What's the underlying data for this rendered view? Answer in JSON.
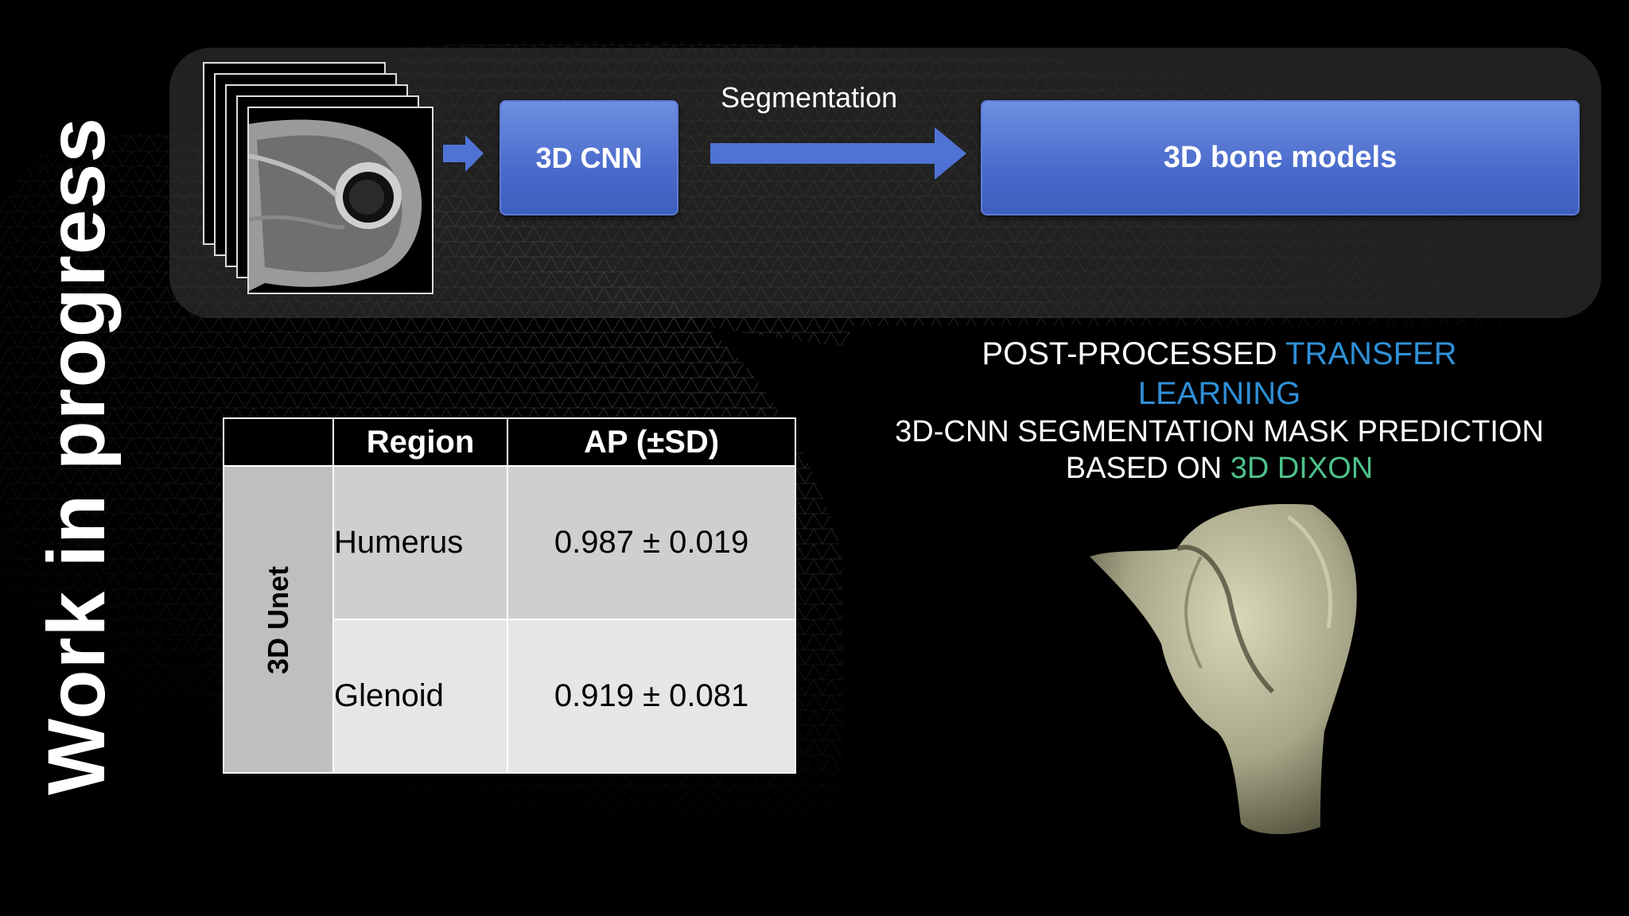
{
  "slide": {
    "vertical_title": "Work in progress"
  },
  "pipeline": {
    "input_icon": "mri-slice-stack-icon",
    "cnn_label": "3D CNN",
    "arrow_label": "Segmentation",
    "output_label": "3D bone models",
    "box_color": "#4a6bcc"
  },
  "table": {
    "headers": [
      "",
      "Region",
      "AP (±SD)"
    ],
    "row_group_label": "3D Unet",
    "rows": [
      {
        "region": "Humerus",
        "value": "0.987 ± 0.019"
      },
      {
        "region": "Glenoid",
        "value": "0.919 ± 0.081"
      }
    ]
  },
  "caption": {
    "line1_part1": "POST-PROCESSED ",
    "line1_part2": "TRANSFER",
    "line2": "LEARNING",
    "line3": "3D-CNN SEGMENTATION MASK PREDICTION",
    "line4_part1": "BASED ON ",
    "line4_part2": "3D DIXON",
    "highlight_blue": "#2f8fd6",
    "highlight_green": "#4fc18a"
  },
  "render": {
    "icon": "humerus-bone-render-icon"
  }
}
